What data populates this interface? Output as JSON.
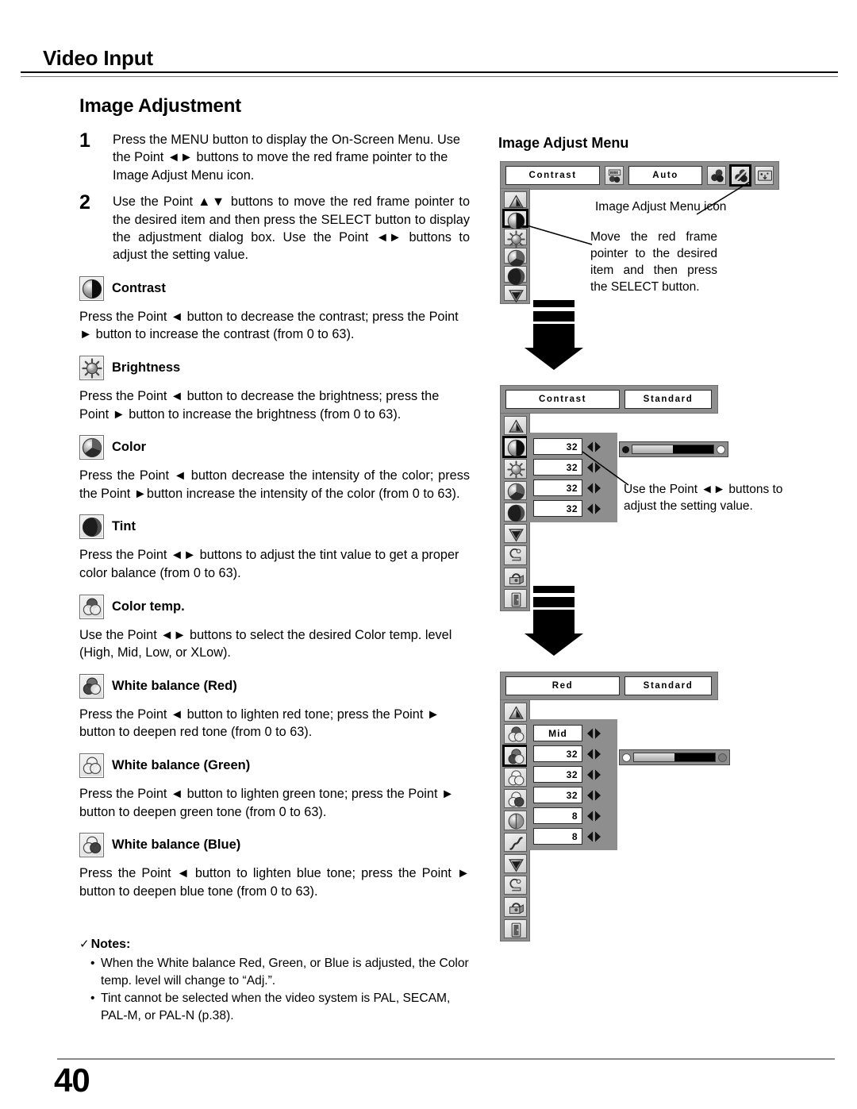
{
  "header": {
    "title": "Video Input"
  },
  "footer": {
    "page_number": "40"
  },
  "section": {
    "title": "Image Adjustment"
  },
  "steps": [
    {
      "num": "1",
      "text": "Press the MENU button to display the On-Screen Menu. Use the Point ◄► buttons to move the red frame pointer to the Image Adjust Menu icon."
    },
    {
      "num": "2",
      "text": "Use the Point ▲▼ buttons to move the red frame pointer to the desired item and then press the SELECT button to display the adjustment dialog box. Use the Point ◄► buttons to adjust the setting value."
    }
  ],
  "items": [
    {
      "icon": "contrast-icon",
      "title": "Contrast",
      "body": "Press the Point ◄ button to decrease the contrast; press the Point ► button to increase the contrast (from 0 to 63)."
    },
    {
      "icon": "brightness-icon",
      "title": "Brightness",
      "body": "Press the Point ◄ button to decrease the brightness; press the Point ► button to increase the brightness (from 0 to 63)."
    },
    {
      "icon": "color-icon",
      "title": "Color",
      "body": "Press the Point ◄ button decrease the intensity of the color; press the Point ►button increase the intensity of the color (from 0 to 63)."
    },
    {
      "icon": "tint-icon",
      "title": "Tint",
      "body": "Press the Point ◄► buttons to adjust the tint value to get a proper color balance (from 0 to 63)."
    },
    {
      "icon": "color-temp-icon",
      "title": "Color temp.",
      "body": "Use the Point ◄► buttons to select the desired Color temp. level (High, Mid, Low, or XLow)."
    },
    {
      "icon": "white-balance-red-icon",
      "title": "White balance (Red)",
      "body": "Press the Point ◄ button to lighten red tone; press the Point ► button to deepen red tone (from 0 to 63)."
    },
    {
      "icon": "white-balance-green-icon",
      "title": "White balance (Green)",
      "body": "Press the Point ◄ button to lighten green tone; press the Point ► button to deepen green tone (from 0 to 63)."
    },
    {
      "icon": "white-balance-blue-icon",
      "title": "White balance (Blue)",
      "body": "Press the Point ◄ button to lighten blue tone; press the Point ► button to deepen blue tone (from 0 to 63)."
    }
  ],
  "notes": {
    "heading": "Notes:",
    "check": "✓",
    "list": [
      "When the White balance Red, Green, or Blue is adjusted, the Color temp. level will change to “Adj.”.",
      "Tint cannot be selected when the video system is PAL, SECAM, PAL-M, or PAL-N (p.38)."
    ]
  },
  "right": {
    "heading": "Image Adjust Menu",
    "menu_panel": {
      "field_left": "Contrast",
      "field_right": "Auto",
      "icons": [
        "input-source-icon",
        "color-balls-icon",
        "image-adjust-menu-icon",
        "screen-icon"
      ],
      "selected_icon_index": 2,
      "sidebar": [
        "up-arrow-icon",
        "contrast-icon",
        "brightness-icon",
        "color-icon",
        "tint-icon",
        "down-arrow-icon"
      ],
      "sidebar_selected_index": 1,
      "callout_menu_icon": "Image Adjust Menu icon",
      "callout_pointer": "Move the red frame pointer to the desired item and then press the SELECT button."
    },
    "dialog_panel": {
      "field_left": "Contrast",
      "field_right": "Standard",
      "values": [
        "32",
        "32",
        "32",
        "32"
      ],
      "sidebar": [
        "up-arrow-icon",
        "contrast-icon",
        "brightness-icon",
        "color-icon",
        "tint-icon",
        "down-arrow-icon",
        "reset-icon",
        "store-icon",
        "quit-icon"
      ],
      "sidebar_selected_index": 1,
      "slider_percent": 50,
      "callout": "Use the Point ◄► buttons to adjust the setting value."
    },
    "white_balance_panel": {
      "field_left": "Red",
      "field_right": "Standard",
      "values": [
        "Mid",
        "32",
        "32",
        "32",
        "8",
        "8"
      ],
      "sidebar": [
        "up-arrow-icon",
        "color-temp-icon",
        "white-balance-red-icon",
        "white-balance-green-icon",
        "white-balance-blue-icon",
        "sharpness-icon",
        "gamma-icon",
        "down-arrow-icon",
        "reset-icon",
        "store-icon",
        "quit-icon"
      ],
      "sidebar_selected_index": 2,
      "slider_percent": 50
    }
  },
  "colors": {
    "osd_gray": "#8e8e8e",
    "osd_border": "#6e6e6e",
    "field_white": "#ffffff",
    "text_black": "#000000"
  }
}
